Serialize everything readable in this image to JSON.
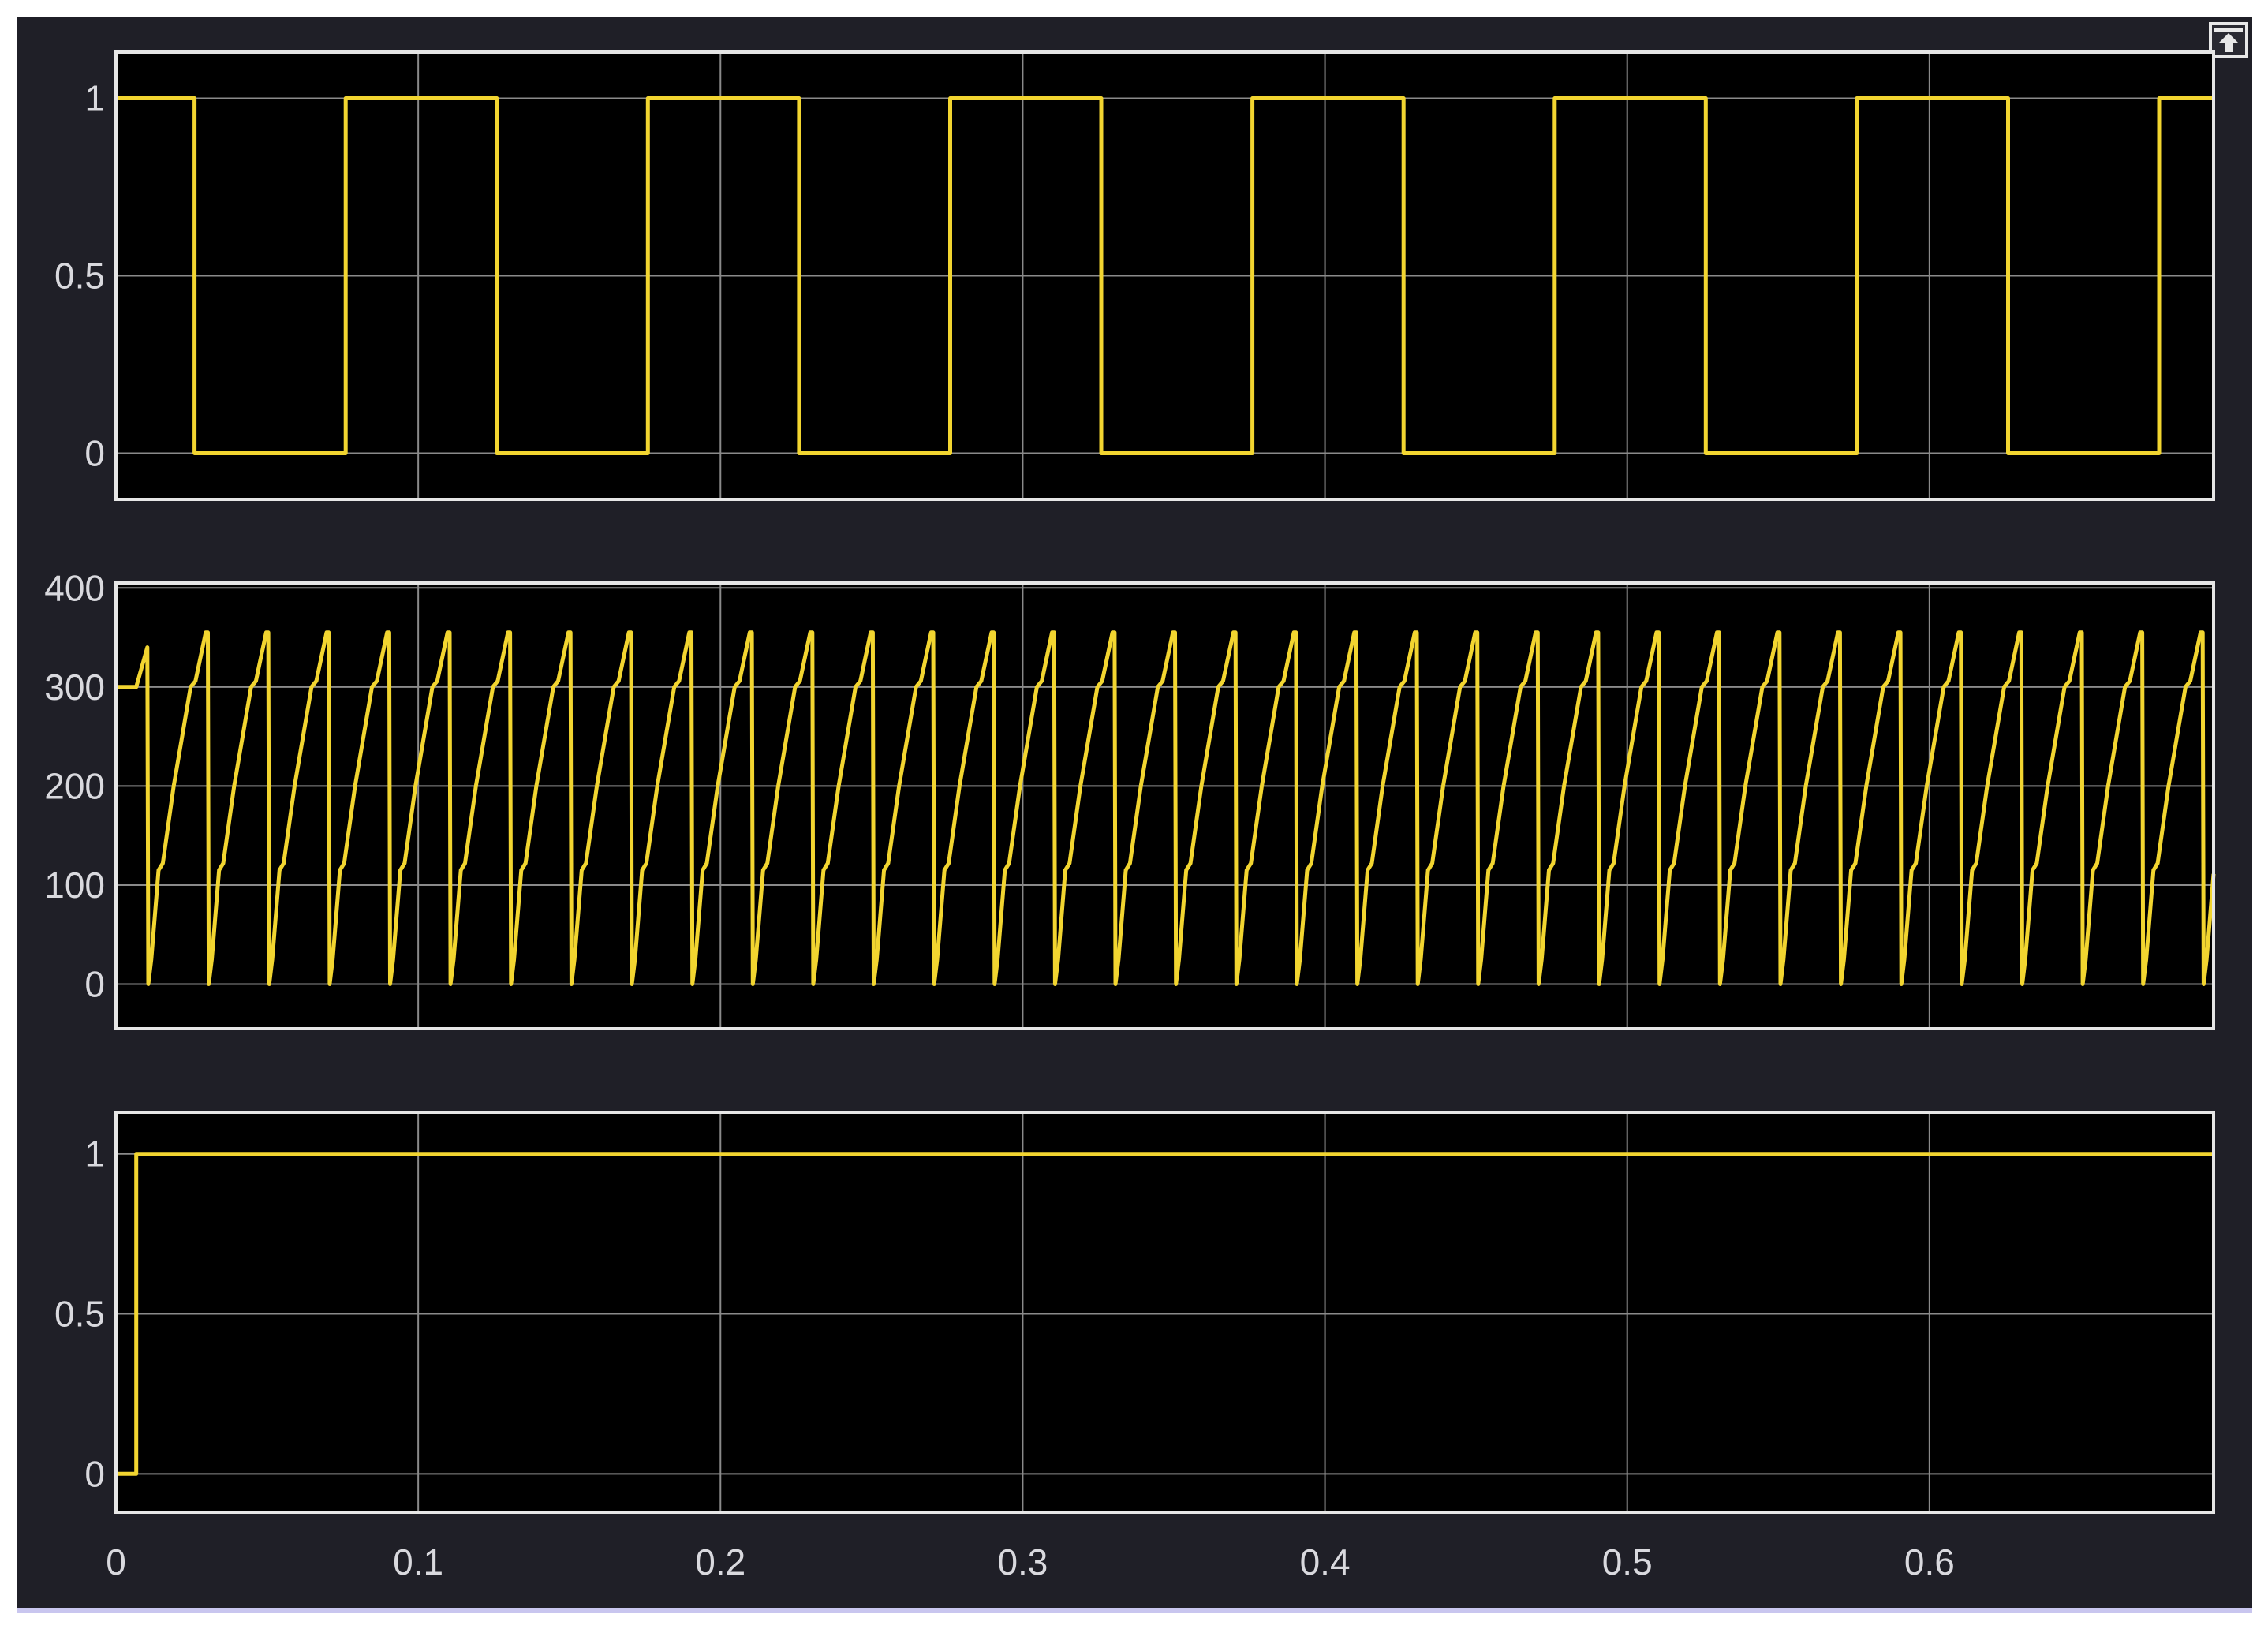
{
  "window": {
    "undock_icon": "undock-arrow-icon"
  },
  "colors": {
    "background": "#1f1f27",
    "axes_bg": "#000000",
    "signal": "#f2d530",
    "grid": "#8a8a8a",
    "axes_border": "#e6e6e6",
    "tick_text": "#d9d9de"
  },
  "chart_data": [
    {
      "type": "line",
      "name": "square-wave",
      "xlim": [
        0,
        0.694
      ],
      "ylim": [
        -0.13,
        1.13
      ],
      "yticks": [
        0,
        0.5,
        1
      ],
      "ytick_labels": [
        "0",
        "0.5",
        "1"
      ],
      "grid": true,
      "signal": {
        "kind": "square",
        "period": 0.1,
        "duty": 0.5,
        "first_fall": 0.026,
        "high": 1,
        "low": 0
      }
    },
    {
      "type": "line",
      "name": "sawtooth-signal",
      "xlim": [
        0,
        0.694
      ],
      "ylim": [
        -45,
        405
      ],
      "yticks": [
        0,
        100,
        200,
        300,
        400
      ],
      "ytick_labels": [
        "0",
        "100",
        "200",
        "300",
        "400"
      ],
      "grid": true,
      "signal": {
        "kind": "periodic",
        "initial": {
          "t": [
            0,
            0.0067,
            0.0104,
            0.0107
          ],
          "v": [
            300,
            300,
            340,
            0
          ]
        },
        "first_cycle_start": 0.0107,
        "period": 0.02,
        "cycle_phase": [
          0,
          0.05,
          0.17,
          0.24,
          0.42,
          0.7,
          0.78,
          0.95,
          0.985,
          1.0
        ],
        "cycle_values": [
          0,
          25,
          115,
          122,
          200,
          300,
          306,
          355,
          355,
          0
        ]
      }
    },
    {
      "type": "line",
      "name": "step-signal",
      "xlim": [
        0,
        0.694
      ],
      "ylim": [
        -0.12,
        1.13
      ],
      "yticks": [
        0,
        0.5,
        1
      ],
      "ytick_labels": [
        "0",
        "0.5",
        "1"
      ],
      "grid": true,
      "signal": {
        "kind": "step",
        "step_time": 0.0067,
        "before": 0,
        "after": 1
      }
    }
  ],
  "xaxis": {
    "ticks": [
      0,
      0.1,
      0.2,
      0.3,
      0.4,
      0.5,
      0.6
    ],
    "tick_labels": [
      "0",
      "0.1",
      "0.2",
      "0.3",
      "0.4",
      "0.5",
      "0.6"
    ]
  }
}
